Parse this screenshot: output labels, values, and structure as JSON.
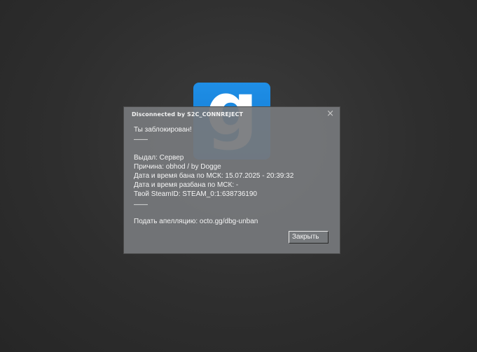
{
  "background": {
    "logo_letter": "g",
    "logo_color": "#1487e0"
  },
  "dialog": {
    "title": "Disconnected by S2C_CONNREJECT",
    "close_icon": "×",
    "lines": {
      "heading": "Ты заблокирован!",
      "separator_top": "——",
      "issued_by": "Выдал: Сервер",
      "reason": "Причина: obhod / by Dogge",
      "ban_time": "Дата и время бана по МСК: 15.07.2025 - 20:39:32",
      "unban_time": "Дата и время разбана по МСК: -",
      "steamid": "Твой SteamID: STEAM_0:1:638736190",
      "separator_bottom": "——",
      "appeal": "Подать апелляцию: octo.gg/dbg-unban"
    },
    "close_button_label": "Закрыть"
  }
}
